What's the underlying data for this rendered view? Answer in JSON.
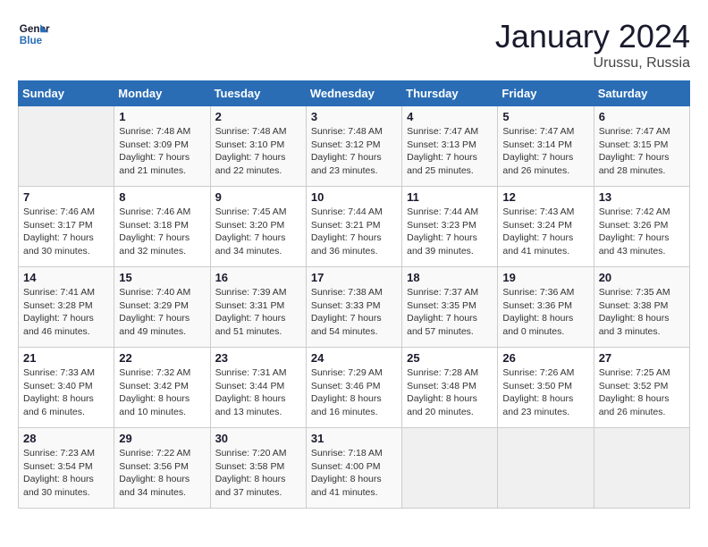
{
  "header": {
    "logo_line1": "General",
    "logo_line2": "Blue",
    "month_title": "January 2024",
    "location": "Urussu, Russia"
  },
  "weekdays": [
    "Sunday",
    "Monday",
    "Tuesday",
    "Wednesday",
    "Thursday",
    "Friday",
    "Saturday"
  ],
  "weeks": [
    [
      {
        "day": "",
        "info": ""
      },
      {
        "day": "1",
        "info": "Sunrise: 7:48 AM\nSunset: 3:09 PM\nDaylight: 7 hours\nand 21 minutes."
      },
      {
        "day": "2",
        "info": "Sunrise: 7:48 AM\nSunset: 3:10 PM\nDaylight: 7 hours\nand 22 minutes."
      },
      {
        "day": "3",
        "info": "Sunrise: 7:48 AM\nSunset: 3:12 PM\nDaylight: 7 hours\nand 23 minutes."
      },
      {
        "day": "4",
        "info": "Sunrise: 7:47 AM\nSunset: 3:13 PM\nDaylight: 7 hours\nand 25 minutes."
      },
      {
        "day": "5",
        "info": "Sunrise: 7:47 AM\nSunset: 3:14 PM\nDaylight: 7 hours\nand 26 minutes."
      },
      {
        "day": "6",
        "info": "Sunrise: 7:47 AM\nSunset: 3:15 PM\nDaylight: 7 hours\nand 28 minutes."
      }
    ],
    [
      {
        "day": "7",
        "info": "Sunrise: 7:46 AM\nSunset: 3:17 PM\nDaylight: 7 hours\nand 30 minutes."
      },
      {
        "day": "8",
        "info": "Sunrise: 7:46 AM\nSunset: 3:18 PM\nDaylight: 7 hours\nand 32 minutes."
      },
      {
        "day": "9",
        "info": "Sunrise: 7:45 AM\nSunset: 3:20 PM\nDaylight: 7 hours\nand 34 minutes."
      },
      {
        "day": "10",
        "info": "Sunrise: 7:44 AM\nSunset: 3:21 PM\nDaylight: 7 hours\nand 36 minutes."
      },
      {
        "day": "11",
        "info": "Sunrise: 7:44 AM\nSunset: 3:23 PM\nDaylight: 7 hours\nand 39 minutes."
      },
      {
        "day": "12",
        "info": "Sunrise: 7:43 AM\nSunset: 3:24 PM\nDaylight: 7 hours\nand 41 minutes."
      },
      {
        "day": "13",
        "info": "Sunrise: 7:42 AM\nSunset: 3:26 PM\nDaylight: 7 hours\nand 43 minutes."
      }
    ],
    [
      {
        "day": "14",
        "info": "Sunrise: 7:41 AM\nSunset: 3:28 PM\nDaylight: 7 hours\nand 46 minutes."
      },
      {
        "day": "15",
        "info": "Sunrise: 7:40 AM\nSunset: 3:29 PM\nDaylight: 7 hours\nand 49 minutes."
      },
      {
        "day": "16",
        "info": "Sunrise: 7:39 AM\nSunset: 3:31 PM\nDaylight: 7 hours\nand 51 minutes."
      },
      {
        "day": "17",
        "info": "Sunrise: 7:38 AM\nSunset: 3:33 PM\nDaylight: 7 hours\nand 54 minutes."
      },
      {
        "day": "18",
        "info": "Sunrise: 7:37 AM\nSunset: 3:35 PM\nDaylight: 7 hours\nand 57 minutes."
      },
      {
        "day": "19",
        "info": "Sunrise: 7:36 AM\nSunset: 3:36 PM\nDaylight: 8 hours\nand 0 minutes."
      },
      {
        "day": "20",
        "info": "Sunrise: 7:35 AM\nSunset: 3:38 PM\nDaylight: 8 hours\nand 3 minutes."
      }
    ],
    [
      {
        "day": "21",
        "info": "Sunrise: 7:33 AM\nSunset: 3:40 PM\nDaylight: 8 hours\nand 6 minutes."
      },
      {
        "day": "22",
        "info": "Sunrise: 7:32 AM\nSunset: 3:42 PM\nDaylight: 8 hours\nand 10 minutes."
      },
      {
        "day": "23",
        "info": "Sunrise: 7:31 AM\nSunset: 3:44 PM\nDaylight: 8 hours\nand 13 minutes."
      },
      {
        "day": "24",
        "info": "Sunrise: 7:29 AM\nSunset: 3:46 PM\nDaylight: 8 hours\nand 16 minutes."
      },
      {
        "day": "25",
        "info": "Sunrise: 7:28 AM\nSunset: 3:48 PM\nDaylight: 8 hours\nand 20 minutes."
      },
      {
        "day": "26",
        "info": "Sunrise: 7:26 AM\nSunset: 3:50 PM\nDaylight: 8 hours\nand 23 minutes."
      },
      {
        "day": "27",
        "info": "Sunrise: 7:25 AM\nSunset: 3:52 PM\nDaylight: 8 hours\nand 26 minutes."
      }
    ],
    [
      {
        "day": "28",
        "info": "Sunrise: 7:23 AM\nSunset: 3:54 PM\nDaylight: 8 hours\nand 30 minutes."
      },
      {
        "day": "29",
        "info": "Sunrise: 7:22 AM\nSunset: 3:56 PM\nDaylight: 8 hours\nand 34 minutes."
      },
      {
        "day": "30",
        "info": "Sunrise: 7:20 AM\nSunset: 3:58 PM\nDaylight: 8 hours\nand 37 minutes."
      },
      {
        "day": "31",
        "info": "Sunrise: 7:18 AM\nSunset: 4:00 PM\nDaylight: 8 hours\nand 41 minutes."
      },
      {
        "day": "",
        "info": ""
      },
      {
        "day": "",
        "info": ""
      },
      {
        "day": "",
        "info": ""
      }
    ]
  ]
}
